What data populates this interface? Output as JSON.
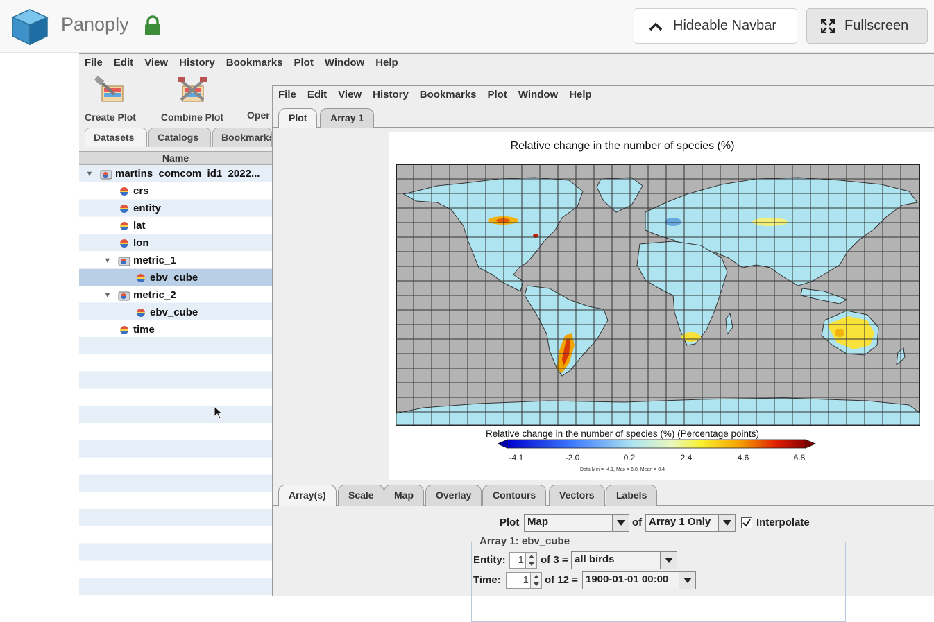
{
  "navbar": {
    "app_title": "Panoply",
    "hide_button": "Hideable Navbar",
    "fullscreen_button": "Fullscreen",
    "icons": [
      "cube-logo-icon",
      "lock-icon",
      "chevron-up-icon",
      "expand-icon"
    ]
  },
  "main_menu": [
    "File",
    "Edit",
    "View",
    "History",
    "Bookmarks",
    "Plot",
    "Window",
    "Help"
  ],
  "toolbar": {
    "create_plot": "Create Plot",
    "combine_plot": "Combine Plot",
    "open": "Oper"
  },
  "dataset_tabs": [
    "Datasets",
    "Catalogs",
    "Bookmarks"
  ],
  "tree": {
    "header": "Name",
    "items": [
      {
        "label": "martins_comcom_id1_2022...",
        "kind": "dataset",
        "expanded": true
      },
      {
        "label": "crs",
        "kind": "variable"
      },
      {
        "label": "entity",
        "kind": "variable"
      },
      {
        "label": "lat",
        "kind": "variable"
      },
      {
        "label": "lon",
        "kind": "variable"
      },
      {
        "label": "metric_1",
        "kind": "group",
        "expanded": true
      },
      {
        "label": "ebv_cube",
        "kind": "variable",
        "selected": true
      },
      {
        "label": "metric_2",
        "kind": "group",
        "expanded": true
      },
      {
        "label": "ebv_cube",
        "kind": "variable"
      },
      {
        "label": "time",
        "kind": "variable"
      }
    ]
  },
  "plot_window": {
    "menu": [
      "File",
      "Edit",
      "View",
      "History",
      "Bookmarks",
      "Plot",
      "Window",
      "Help"
    ],
    "tabs": [
      "Plot",
      "Array 1"
    ],
    "active_tab": "Plot"
  },
  "plot": {
    "title": "Relative change in the number of species (%)",
    "colorbar_label": "Relative change in the number of species (%) (Percentage points)",
    "colorbar_ticks": [
      "-4.1",
      "-2.0",
      "0.2",
      "2.4",
      "4.6",
      "6.8"
    ],
    "stats": "Data Min = -4.1, Max = 6.8, Mean = 0.4",
    "colors": {
      "ocean": "#b3b3b3",
      "land": "#aee4f0",
      "grid": "#333333"
    }
  },
  "settings": {
    "tabs": [
      "Array(s)",
      "Scale",
      "Map",
      "Overlay",
      "Contours",
      "Vectors",
      "Labels"
    ],
    "active_tab": "Array(s)",
    "plot_label": "Plot",
    "plot_type": "Map",
    "of_label": "of",
    "array_mode": "Array 1 Only",
    "interpolate_label": "Interpolate",
    "interpolate_checked": true,
    "group_title": "Array 1: ebv_cube",
    "entity_label": "Entity:",
    "entity_index": "1",
    "entity_of": "of 3 =",
    "entity_value": "all birds",
    "time_label": "Time:",
    "time_index": "1",
    "time_of": "of 12 =",
    "time_value": "1900-01-01 00:00"
  }
}
